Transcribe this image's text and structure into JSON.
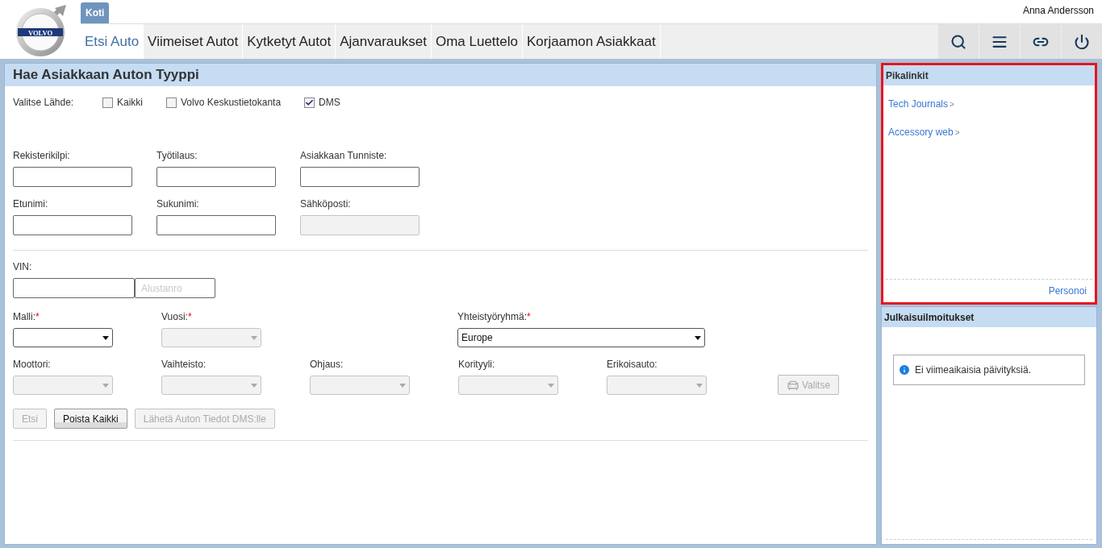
{
  "logo": {
    "text": "VOLVO"
  },
  "top_tab": {
    "label": "Koti",
    "selected": true
  },
  "user": "Anna Andersson",
  "nav": [
    {
      "label": "Etsi Auto",
      "selected": true
    },
    {
      "label": "Viimeiset Autot",
      "selected": false
    },
    {
      "label": "Kytketyt Autot",
      "selected": false
    },
    {
      "label": "Ajanvaraukset",
      "selected": false
    },
    {
      "label": "Oma Luettelo",
      "selected": false
    },
    {
      "label": "Korjaamon Asiakkaat",
      "selected": false
    }
  ],
  "toolbar": [
    {
      "kind": "search"
    },
    {
      "kind": "menu"
    },
    {
      "kind": "link"
    },
    {
      "kind": "power"
    }
  ],
  "form": {
    "title": "Hae Asiakkaan Auton Tyyppi",
    "source": {
      "label": "Valitse Lähde:",
      "options": [
        {
          "label": "Kaikki",
          "checked": false
        },
        {
          "label": "Volvo Keskustietokanta",
          "checked": false
        },
        {
          "label": "DMS",
          "checked": true
        }
      ]
    },
    "text_fields": [
      [
        {
          "label": "Rekisterikilpi:",
          "disabled": false
        },
        {
          "label": "Työtilaus:",
          "disabled": false
        },
        {
          "label": "Asiakkaan Tunniste:",
          "disabled": false
        }
      ],
      [
        {
          "label": "Etunimi:",
          "disabled": false
        },
        {
          "label": "Sukunimi:",
          "disabled": false
        },
        {
          "label": "Sähköposti:",
          "disabled": true
        }
      ]
    ],
    "vin": {
      "label": "VIN:",
      "placeholder": "Alustanro"
    },
    "selects_top": [
      {
        "label": "Malli:",
        "required_mark": "*",
        "disabled": false,
        "wide": false
      },
      {
        "label": "Vuosi:",
        "required_mark": "*",
        "disabled": true,
        "wide": false
      },
      {
        "label": "Yhteistyöryhmä:",
        "required_mark": "*",
        "disabled": false,
        "value": "Europe",
        "wide": true
      }
    ],
    "selects_bottom": [
      {
        "label": "Moottori:",
        "disabled": true
      },
      {
        "label": "Vaihteisto:",
        "disabled": true
      },
      {
        "label": "Ohjaus:",
        "disabled": true
      },
      {
        "label": "Korityyli:",
        "disabled": true
      },
      {
        "label": "Erikoisauto:",
        "disabled": true
      }
    ],
    "choose_button": {
      "label": "Valitse",
      "disabled": true
    },
    "buttons": [
      {
        "label": "Etsi",
        "disabled": true
      },
      {
        "label": "Poista Kaikki",
        "disabled": false
      },
      {
        "label": "Lähetä Auton Tiedot DMS:lle",
        "disabled": true
      }
    ]
  },
  "quick_links": {
    "title": "Pikalinkit",
    "highlighted": true,
    "links": [
      {
        "label": "Tech Journals",
        "arrow": ">"
      },
      {
        "label": "Accessory web",
        "arrow": ">"
      }
    ],
    "footer_link": "Personoi"
  },
  "releases": {
    "title": "Julkaisuilmoitukset",
    "notice": "Ei viimeaikaisia päivityksiä."
  }
}
